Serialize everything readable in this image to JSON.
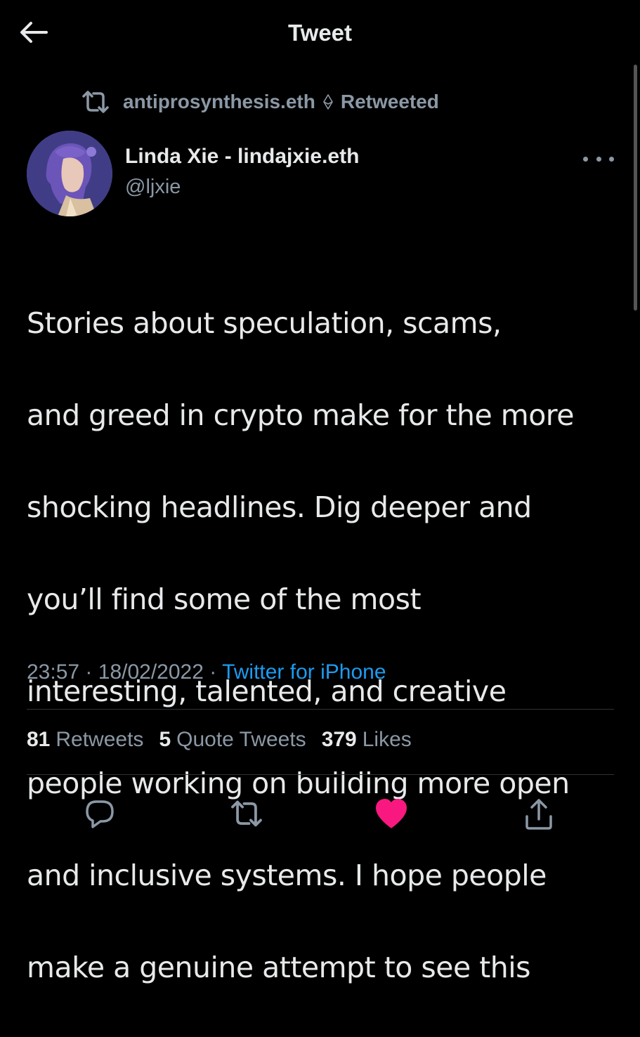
{
  "header": {
    "title": "Tweet"
  },
  "retweet_context": {
    "retweeter": "antiprosynthesis.eth",
    "label": "Retweeted"
  },
  "author": {
    "display_name": "Linda Xie - lindajxie.eth",
    "handle": "@ljxie"
  },
  "tweet": {
    "text_lines": [
      "Stories about speculation, scams,",
      "and greed in crypto make for the more",
      "shocking headlines. Dig deeper and",
      "you’ll find some of the most",
      "interesting, talented, and creative",
      "people working on building more open",
      "and inclusive systems. I hope people",
      "make a genuine attempt to see this"
    ],
    "time": "23:57",
    "separator": "·",
    "date": "18/02/2022",
    "source": "Twitter for iPhone"
  },
  "stats": {
    "retweets_count": "81",
    "retweets_label": "Retweets",
    "quotes_count": "5",
    "quotes_label": "Quote Tweets",
    "likes_count": "379",
    "likes_label": "Likes"
  },
  "icons": {
    "back": "back-arrow-icon",
    "retweet": "retweet-icon",
    "eth": "ethereum-icon",
    "more": "more-icon",
    "reply": "reply-icon",
    "like": "heart-icon",
    "share": "share-icon"
  },
  "colors": {
    "background": "#000000",
    "text": "#e7e9ea",
    "secondary": "#8b98a5",
    "link": "#1d9bf0",
    "like": "#f91880"
  }
}
